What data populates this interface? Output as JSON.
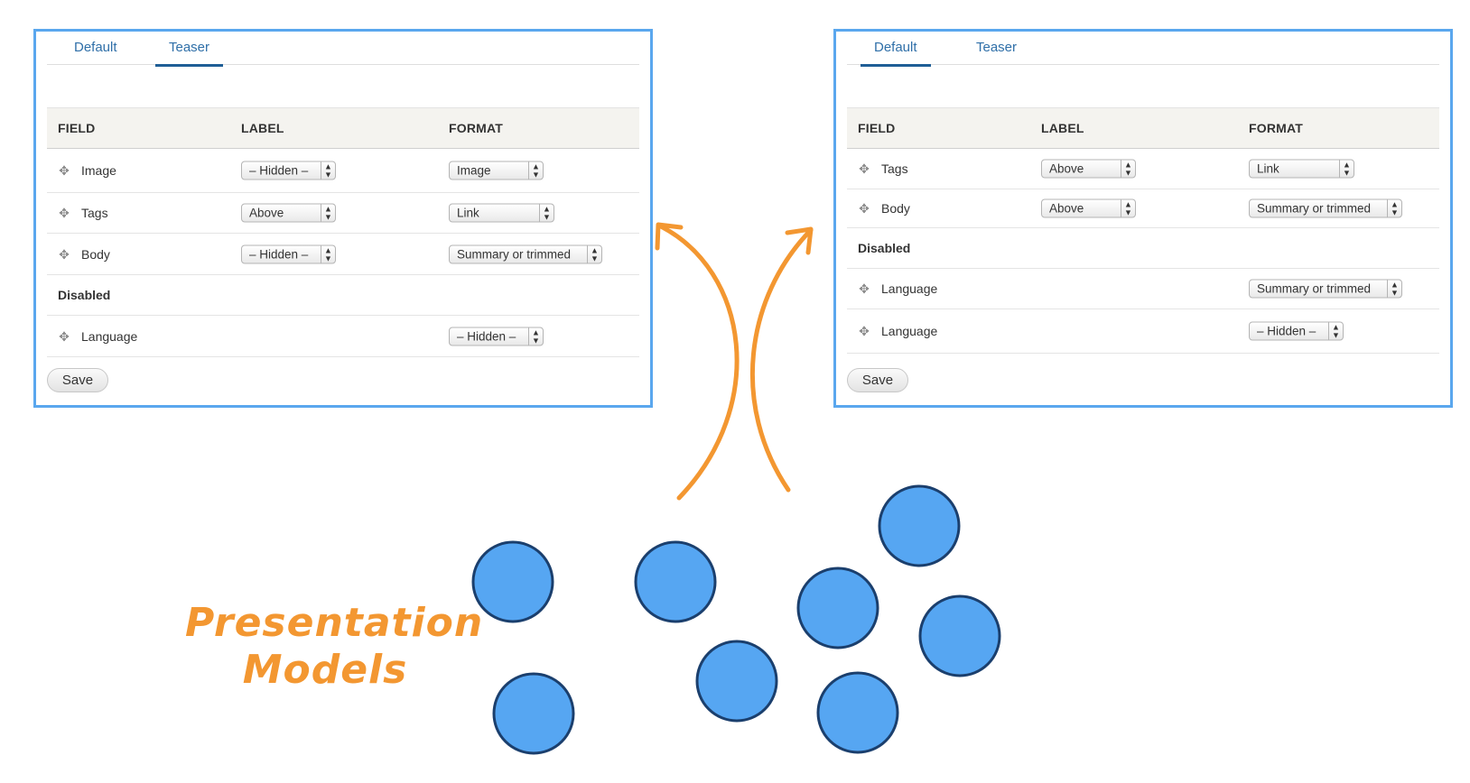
{
  "left_panel": {
    "tabs": [
      {
        "label": "Default",
        "active": false
      },
      {
        "label": "Teaser",
        "active": true
      }
    ],
    "headers": {
      "field": "FIELD",
      "label": "LABEL",
      "format": "FORMAT"
    },
    "rows": [
      {
        "field": "Image",
        "label_value": "– Hidden –",
        "format_value": "Image"
      },
      {
        "field": "Tags",
        "label_value": "Above",
        "format_value": "Link"
      },
      {
        "field": "Body",
        "label_value": "– Hidden –",
        "format_value": "Summary or trimmed"
      }
    ],
    "disabled_label": "Disabled",
    "disabled_rows": [
      {
        "field": "Language",
        "format_value": "– Hidden –"
      }
    ],
    "save_label": "Save"
  },
  "right_panel": {
    "tabs": [
      {
        "label": "Default",
        "active": true
      },
      {
        "label": "Teaser",
        "active": false
      }
    ],
    "headers": {
      "field": "FIELD",
      "label": "LABEL",
      "format": "FORMAT"
    },
    "rows": [
      {
        "field": "Tags",
        "label_value": "Above",
        "format_value": "Link"
      },
      {
        "field": "Body",
        "label_value": "Above",
        "format_value": "Summary or trimmed"
      }
    ],
    "disabled_label": "Disabled",
    "disabled_rows": [
      {
        "field": "Language",
        "format_value": "Summary or trimmed"
      },
      {
        "field": "Language",
        "format_value": "– Hidden –"
      }
    ],
    "save_label": "Save"
  },
  "presentation_models": {
    "label_line1": "Presentation",
    "label_line2": "Models",
    "label_color": "#f39731",
    "model_count": 8
  },
  "colors": {
    "panel_border": "#5aa7ee",
    "arrow": "#f39731",
    "circle_fill": "#56a6f2",
    "circle_stroke": "#1b3f6d",
    "tab_text": "#2f6fa8"
  }
}
